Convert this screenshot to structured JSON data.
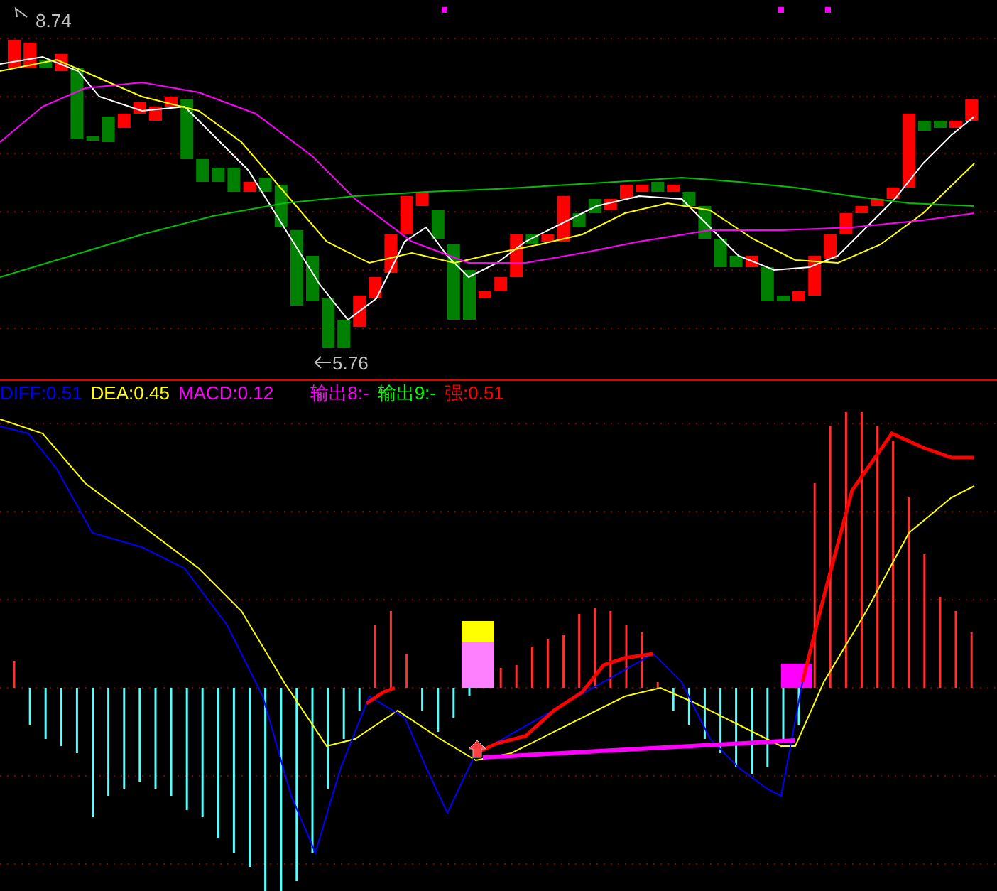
{
  "price_panel": {
    "high_label": "8.74",
    "low_label": "5.76"
  },
  "indicator_legend": [
    {
      "text": "DIFF:0.51",
      "color": "#0000ff"
    },
    {
      "text": "DEA:0.45",
      "color": "#ffff00"
    },
    {
      "text": "MACD:0.12",
      "color": "#ff00ff"
    },
    {
      "text": "输出8:-",
      "color": "#ff00ff"
    },
    {
      "text": "输出9:-",
      "color": "#00ff00"
    },
    {
      "text": "强:0.51",
      "color": "#ff0000"
    }
  ]
}
